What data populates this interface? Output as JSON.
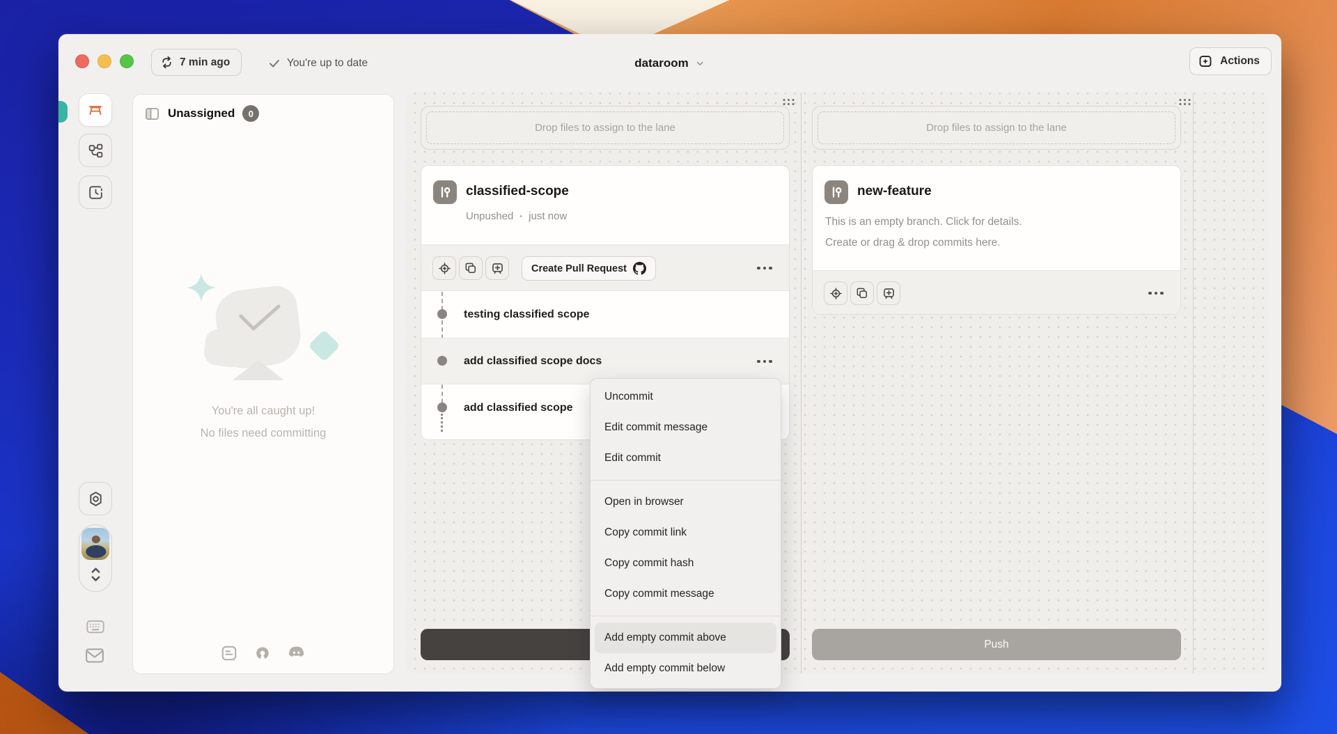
{
  "titlebar": {
    "sync_button": "7 min ago",
    "status_text": "You're up to date",
    "project_name": "dataroom",
    "actions_button": "Actions"
  },
  "sidebar": {
    "tabs": [
      {
        "icon": "workbench-icon",
        "active": true
      },
      {
        "icon": "branches-icon",
        "active": false
      },
      {
        "icon": "history-icon",
        "active": false
      }
    ],
    "settings_icon": "gear-icon",
    "keyboard_icon": "keyboard-icon",
    "mail_icon": "mail-icon"
  },
  "unassigned_panel": {
    "title": "Unassigned",
    "count": "0",
    "empty_state": {
      "line1": "You're all caught up!",
      "line2": "No files need committing"
    },
    "footer_icons": [
      "feedback-icon",
      "open-source-icon",
      "discord-icon"
    ]
  },
  "lanes": {
    "middle": {
      "drop_hint": "Drop files to assign to the lane",
      "branch_name": "classified-scope",
      "push_status": "Unpushed",
      "dot_separator": "•",
      "last_commit_time": "just now",
      "pr_button": "Create Pull Request",
      "commits": [
        {
          "message": "testing classified scope"
        },
        {
          "message": "add classified scope docs"
        },
        {
          "message": "add classified scope"
        }
      ]
    },
    "right": {
      "drop_hint": "Drop files to assign to the lane",
      "branch_name": "new-feature",
      "description_line1": "This is an empty branch. Click for details.",
      "description_line2": "Create or drag & drop commits here.",
      "push_button": "Push"
    }
  },
  "context_menu": {
    "items": [
      {
        "label": "Uncommit"
      },
      {
        "label": "Edit commit message"
      },
      {
        "label": "Edit commit"
      },
      {
        "label": "Open in browser"
      },
      {
        "label": "Copy commit link"
      },
      {
        "label": "Copy commit hash"
      },
      {
        "label": "Copy commit message"
      },
      {
        "label": "Add empty commit above",
        "highlighted": true
      },
      {
        "label": "Add empty commit below"
      }
    ]
  },
  "colors": {
    "accent_orange": "#DF7743",
    "teal_accent": "#38B5A4",
    "branch_badge": "#8B857D",
    "dark_button": "#454240",
    "push_button_gray": "#A8A5A1",
    "traffic_red": "#EC6A5E",
    "traffic_yellow": "#F5BF4F",
    "traffic_green": "#56C549"
  }
}
